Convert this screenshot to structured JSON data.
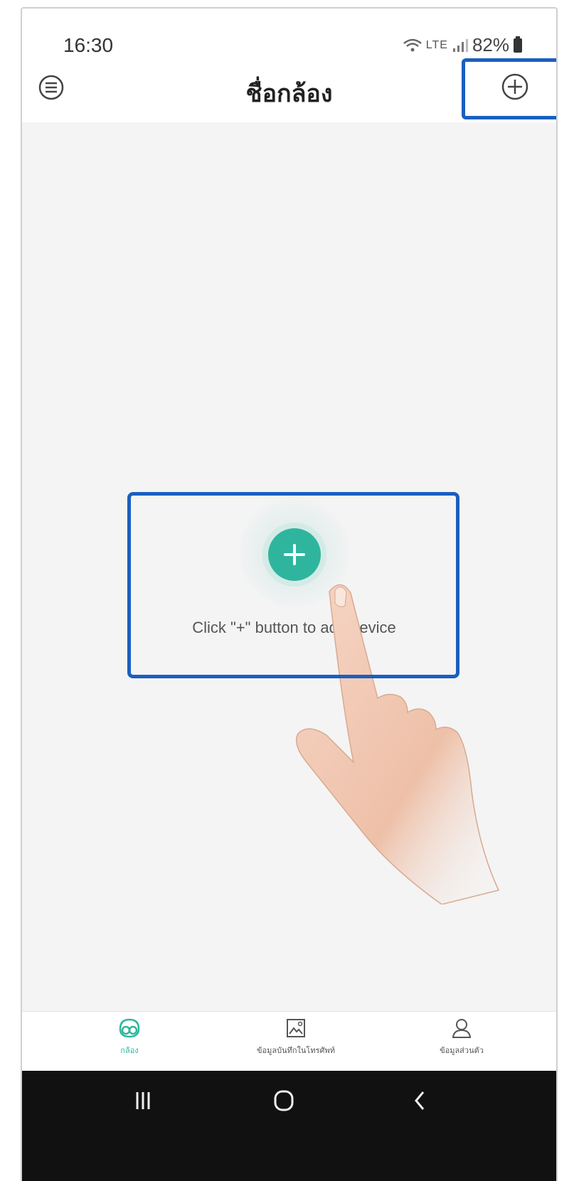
{
  "status_bar": {
    "time": "16:30",
    "network": "LTE",
    "battery": "82%"
  },
  "header": {
    "title": "ชื่อกล้อง",
    "menu_icon": "menu-icon",
    "add_icon": "plus-circle-icon"
  },
  "main": {
    "hint": "Click \"+\" button to add device",
    "add_icon": "plus-icon"
  },
  "tabs": [
    {
      "label": "กล้อง",
      "icon": "camera-home-icon",
      "active": true
    },
    {
      "label": "ข้อมูลบันทึกในโทรศัพท์",
      "icon": "image-icon",
      "active": false
    },
    {
      "label": "ข้อมูลส่วนตัว",
      "icon": "user-icon",
      "active": false
    }
  ],
  "nav_bar": {
    "recents_icon": "recents-icon",
    "home_icon": "home-icon",
    "back_icon": "back-icon"
  },
  "colors": {
    "accent": "#2fb59e",
    "highlight": "#1a5fbf",
    "background": "#f4f4f4",
    "nav_bar": "#111111"
  }
}
